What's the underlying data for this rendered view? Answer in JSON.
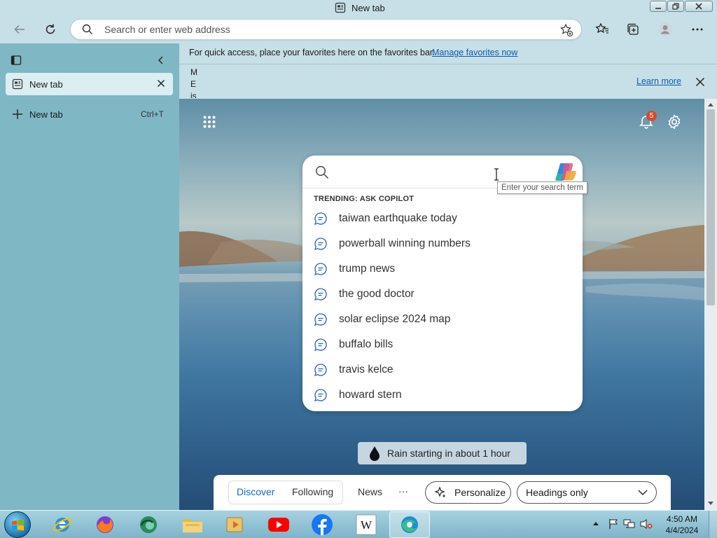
{
  "window": {
    "tab_title": "New tab"
  },
  "toolbar": {
    "address_placeholder": "Search or enter web address"
  },
  "sidebar": {
    "active_tab": "New tab",
    "new_tab_label": "New tab",
    "new_tab_shortcut": "Ctrl+T"
  },
  "favorites_bar": {
    "message": "For quick access, place your favorites here on the favorites bar.",
    "link": "Manage favorites now"
  },
  "infobar": {
    "truncated_lines": [
      "M",
      "E",
      "is"
    ],
    "learn_more": "Learn more"
  },
  "ntp": {
    "notification_count": "5",
    "trending_header": "TRENDING: ASK COPILOT",
    "suggestions": [
      "taiwan earthquake today",
      "powerball winning numbers",
      "trump news",
      "the good doctor",
      "solar eclipse 2024 map",
      "buffalo bills",
      "travis kelce",
      "howard stern"
    ],
    "tooltip": "Enter your search term",
    "weather": "Rain starting in about 1 hour",
    "nav": {
      "discover": "Discover",
      "following": "Following",
      "news": "News",
      "more": "···",
      "personalize": "Personalize",
      "layout_select": "Headings only"
    }
  },
  "taskbar": {
    "time": "4:50 AM",
    "date": "4/4/2024",
    "apps": [
      "Internet Explorer",
      "Firefox",
      "Edge Beta",
      "File Explorer",
      "Media Player",
      "YouTube",
      "Facebook",
      "Wikipedia",
      "Microsoft Edge"
    ]
  },
  "colors": {
    "accent": "#0f6cbd",
    "sidebar": "#7fb7c4",
    "chrome": "#c7dfe6",
    "badge": "#d84a2a"
  }
}
